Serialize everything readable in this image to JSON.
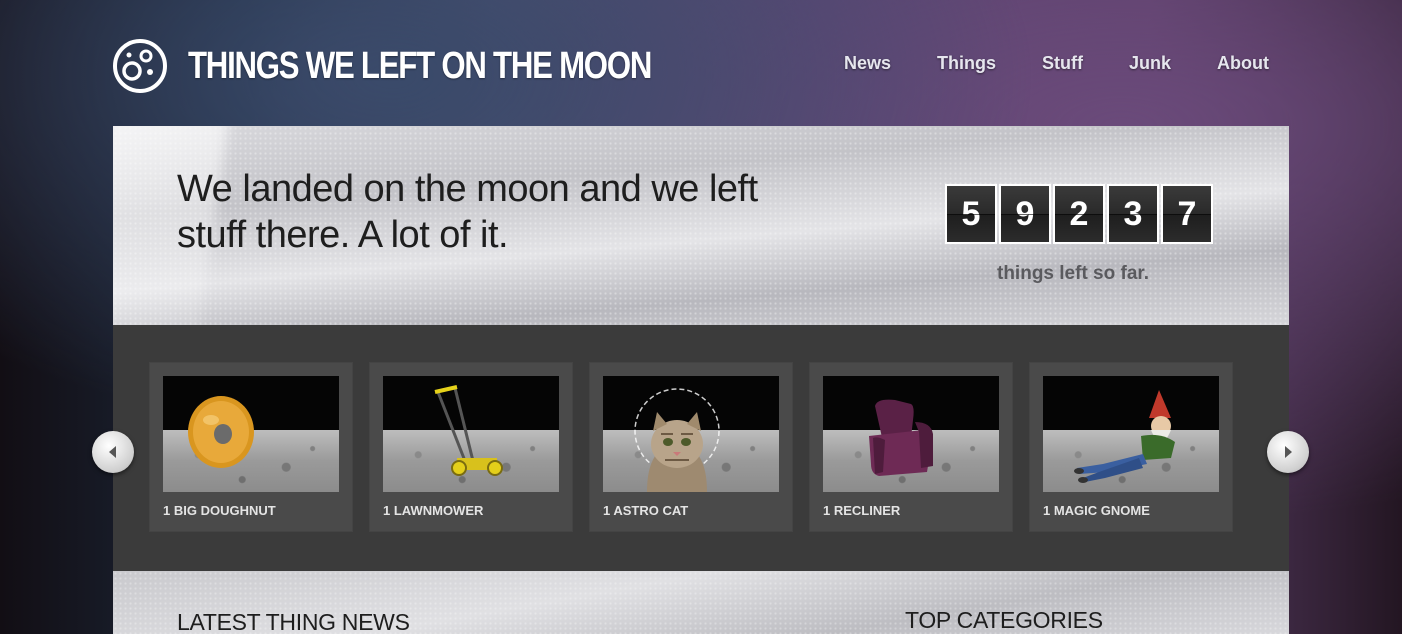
{
  "header": {
    "site_title": "THINGS WE LEFT ON THE MOON",
    "logo_icon": "moon-icon",
    "nav": [
      "News",
      "Things",
      "Stuff",
      "Junk",
      "About"
    ]
  },
  "hero": {
    "headline": "We landed on the moon and we left stuff there. A lot of it.",
    "counter_digits": [
      "5",
      "9",
      "2",
      "3",
      "7"
    ],
    "counter_label": "things left so far."
  },
  "carousel": {
    "prev_icon": "chevron-left-icon",
    "next_icon": "chevron-right-icon",
    "items": [
      {
        "label": "1 BIG DOUGHNUT",
        "icon": "doughnut-icon"
      },
      {
        "label": "1 LAWNMOWER",
        "icon": "lawnmower-icon"
      },
      {
        "label": "1 ASTRO CAT",
        "icon": "astro-cat-icon"
      },
      {
        "label": "1 RECLINER",
        "icon": "recliner-icon"
      },
      {
        "label": "1 MAGIC GNOME",
        "icon": "gnome-icon"
      }
    ]
  },
  "sections": {
    "latest_news": "LATEST THING NEWS",
    "top_categories": "TOP CATEGORIES"
  },
  "colors": {
    "carousel_bg": "#3b3b3b",
    "card_bg": "#4a4a4a",
    "digit_bg": "#2a2a2a"
  }
}
